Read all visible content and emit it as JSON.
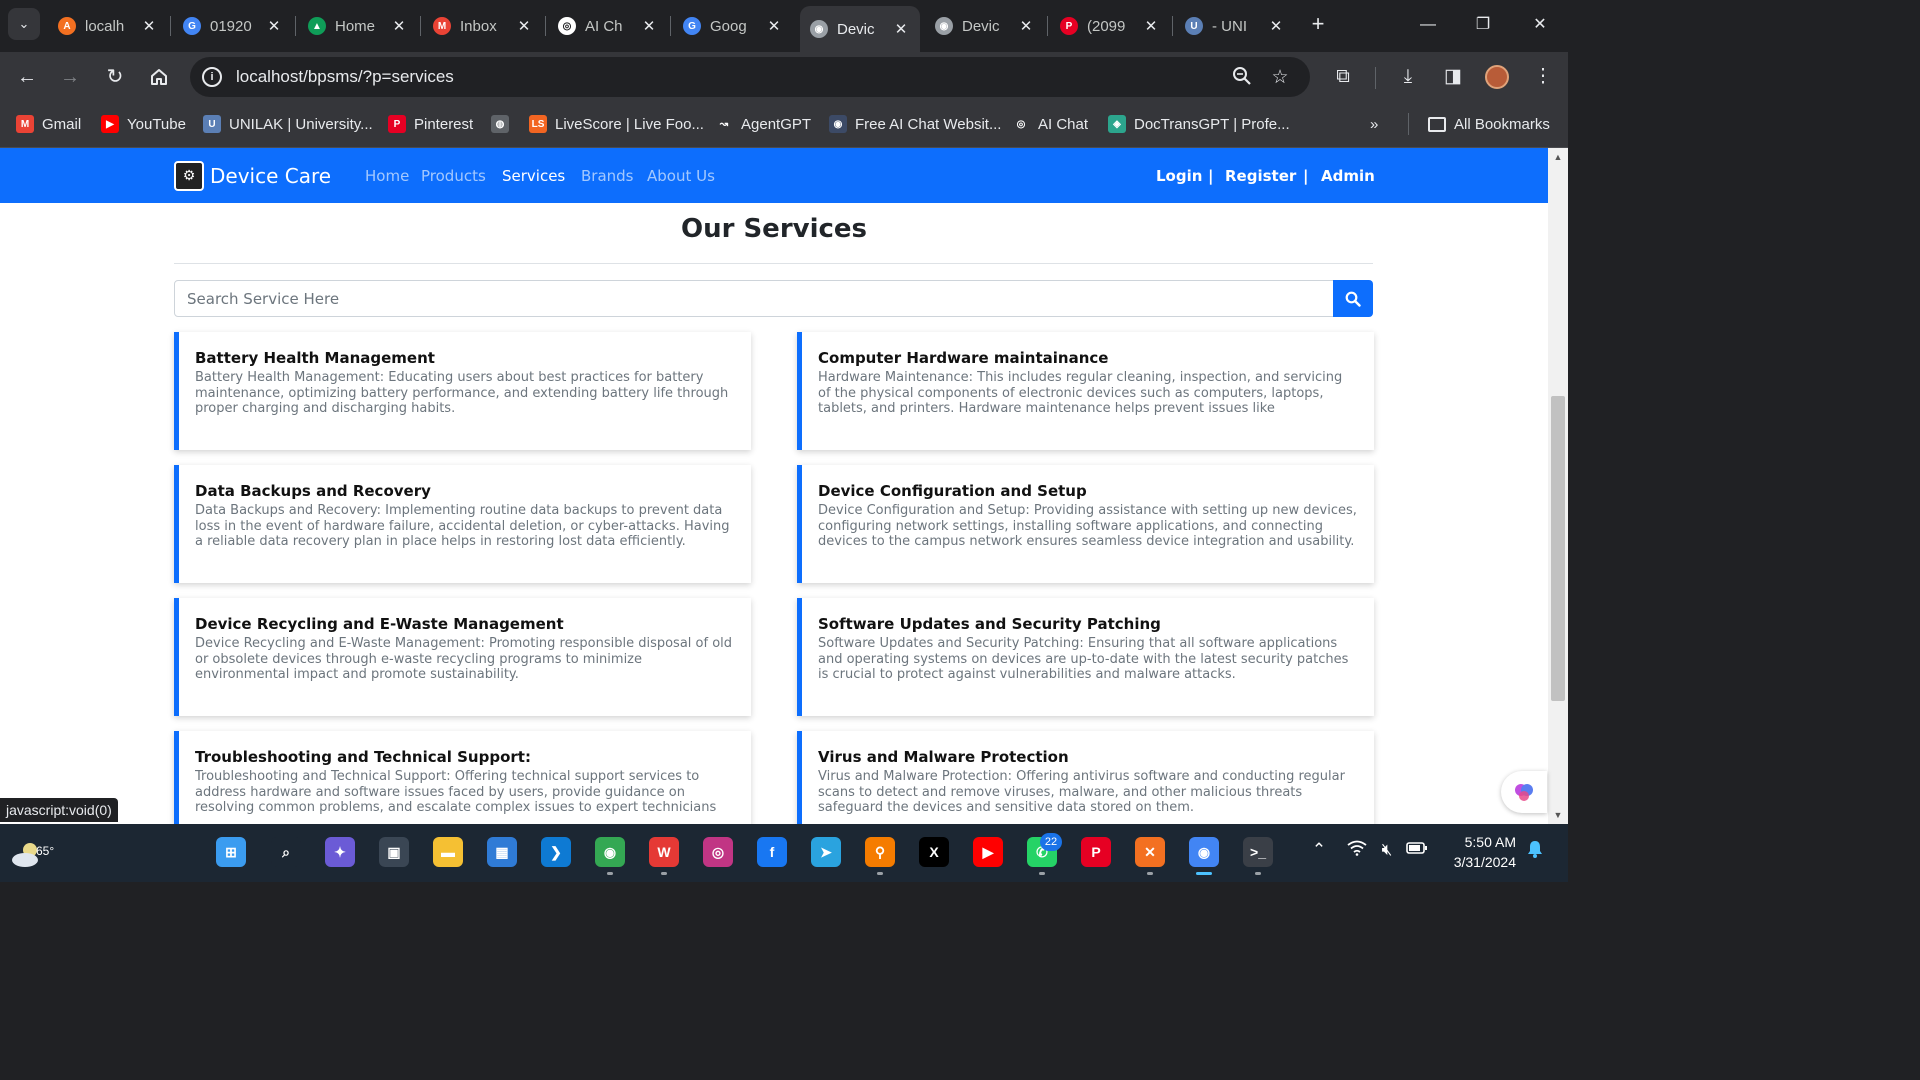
{
  "browser": {
    "tabs": [
      {
        "title": "localh",
        "icon": "xampp-icon",
        "color": "#f37021",
        "glyph": "A"
      },
      {
        "title": "01920",
        "icon": "google-icon",
        "color": "#4285f4",
        "glyph": "G"
      },
      {
        "title": "Home",
        "icon": "drive-icon",
        "color": "#0f9d58",
        "glyph": "▲"
      },
      {
        "title": "Inbox",
        "icon": "gmail-icon",
        "color": "#ea4335",
        "glyph": "M"
      },
      {
        "title": "AI Ch",
        "icon": "openai-icon",
        "color": "#ffffff",
        "glyph": "◎"
      },
      {
        "title": "Goog",
        "icon": "google-icon",
        "color": "#4285f4",
        "glyph": "G"
      },
      {
        "title": "Devic",
        "icon": "device-care-icon",
        "color": "#9aa0a6",
        "glyph": "◉"
      },
      {
        "title": "Devic",
        "icon": "device-care-icon",
        "color": "#9aa0a6",
        "glyph": "◉"
      },
      {
        "title": "(2099",
        "icon": "pinterest-icon",
        "color": "#e60023",
        "glyph": "P"
      },
      {
        "title": "- UNI",
        "icon": "unilak-icon",
        "color": "#5b7fb5",
        "glyph": "U"
      }
    ],
    "active_tab": 6,
    "url": "localhost/bpsms/?p=services",
    "bookmarks": [
      {
        "label": "Gmail",
        "icon": "gmail-icon",
        "color": "#ea4335",
        "glyph": "M"
      },
      {
        "label": "YouTube",
        "icon": "youtube-icon",
        "color": "#ff0000",
        "glyph": "▶"
      },
      {
        "label": "UNILAK | University...",
        "icon": "unilak-icon",
        "color": "#5b7fb5",
        "glyph": "U"
      },
      {
        "label": "Pinterest",
        "icon": "pinterest-icon",
        "color": "#e60023",
        "glyph": "P"
      },
      {
        "label": "",
        "icon": "globe-icon",
        "color": "#5f6368",
        "glyph": "◍"
      },
      {
        "label": "LiveScore | Live Foo...",
        "icon": "livescore-icon",
        "color": "#f26522",
        "glyph": "LS"
      },
      {
        "label": "AgentGPT",
        "icon": "agentgpt-icon",
        "color": "#35363a",
        "glyph": "↝"
      },
      {
        "label": "Free AI Chat Websit...",
        "icon": "ai-chat-icon",
        "color": "#3c4a66",
        "glyph": "◉"
      },
      {
        "label": "AI Chat",
        "icon": "openai-icon",
        "color": "#35363a",
        "glyph": "◎"
      },
      {
        "label": "DocTransGPT | Profe...",
        "icon": "doctrans-icon",
        "color": "#2ca58d",
        "glyph": "◈"
      }
    ],
    "all_bookmarks_label": "All Bookmarks",
    "status_url": "javascript:void(0)"
  },
  "site": {
    "brand": "Device Care",
    "nav": [
      "Home",
      "Products",
      "Services",
      "Brands",
      "About Us"
    ],
    "active_nav": "Services",
    "auth": [
      "Login",
      "Register",
      "Admin"
    ],
    "auth_separator": "|",
    "page_title": "Our Services",
    "search_placeholder": "Search Service Here",
    "search_value": "",
    "accent": "#0d6efd",
    "services": [
      {
        "title": "Battery Health Management",
        "text": "Battery Health Management: Educating users about best practices for battery maintenance, optimizing battery performance, and extending battery life through proper charging and discharging habits."
      },
      {
        "title": "Computer Hardware maintainance",
        "text": "Hardware Maintenance: This includes regular cleaning, inspection, and servicing of the physical components of electronic devices such as computers, laptops, tablets, and printers. Hardware maintenance helps prevent issues like overheating, dust..."
      },
      {
        "title": "Data Backups and Recovery",
        "text": "Data Backups and Recovery: Implementing routine data backups to prevent data loss in the event of hardware failure, accidental deletion, or cyber-attacks. Having a reliable data recovery plan in place helps in restoring lost data efficiently."
      },
      {
        "title": "Device Configuration and Setup",
        "text": "Device Configuration and Setup: Providing assistance with setting up new devices, configuring network settings, installing software applications, and connecting devices to the campus network ensures seamless device integration and usability."
      },
      {
        "title": "Device Recycling and E-Waste Management",
        "text": "Device Recycling and E-Waste Management: Promoting responsible disposal of old or obsolete devices through e-waste recycling programs to minimize environmental impact and promote sustainability."
      },
      {
        "title": "Software Updates and Security Patching",
        "text": "Software Updates and Security Patching: Ensuring that all software applications and operating systems on devices are up-to-date with the latest security patches is crucial to protect against vulnerabilities and malware attacks."
      },
      {
        "title": "Troubleshooting and Technical Support:",
        "text": "Troubleshooting and Technical Support: Offering technical support services to address hardware and software issues faced by users, provide guidance on resolving common problems, and escalate complex issues to expert technicians when needed"
      },
      {
        "title": "Virus and Malware Protection",
        "text": "Virus and Malware Protection: Offering antivirus software and conducting regular scans to detect and remove viruses, malware, and other malicious threats safeguard the devices and sensitive data stored on them."
      }
    ]
  },
  "taskbar": {
    "weather_temp": "65°",
    "whatsapp_badge": "22",
    "time": "5:50 AM",
    "date": "3/31/2024",
    "apps": [
      {
        "icon": "windows-start-icon",
        "color": "#3b9cf0",
        "glyph": "⊞"
      },
      {
        "icon": "search-icon",
        "color": "#1c2733",
        "glyph": "⌕"
      },
      {
        "icon": "copilot-icon",
        "color": "#6b5bd6",
        "glyph": "✦"
      },
      {
        "icon": "task-view-icon",
        "color": "#3a4654",
        "glyph": "▣"
      },
      {
        "icon": "file-explorer-icon",
        "color": "#f5c033",
        "glyph": "▬"
      },
      {
        "icon": "microsoft-store-icon",
        "color": "#2f7bd6",
        "glyph": "▦"
      },
      {
        "icon": "vscode-icon",
        "color": "#0e7ad3",
        "glyph": "❯"
      },
      {
        "icon": "chrome-icon",
        "color": "#34a853",
        "glyph": "◉"
      },
      {
        "icon": "wps-office-icon",
        "color": "#e53935",
        "glyph": "W"
      },
      {
        "icon": "instagram-icon",
        "color": "#c13584",
        "glyph": "◎"
      },
      {
        "icon": "facebook-icon",
        "color": "#1877f2",
        "glyph": "f"
      },
      {
        "icon": "telegram-icon",
        "color": "#2aa3df",
        "glyph": "➤"
      },
      {
        "icon": "search-tool-icon",
        "color": "#f57c00",
        "glyph": "⚲"
      },
      {
        "icon": "x-icon",
        "color": "#000000",
        "glyph": "X"
      },
      {
        "icon": "youtube-icon",
        "color": "#ff0000",
        "glyph": "▶"
      },
      {
        "icon": "whatsapp-icon",
        "color": "#25d366",
        "glyph": "✆"
      },
      {
        "icon": "pinterest-icon",
        "color": "#e60023",
        "glyph": "P"
      },
      {
        "icon": "xampp-icon",
        "color": "#f37021",
        "glyph": "✕"
      },
      {
        "icon": "chrome-profile-icon",
        "color": "#4285f4",
        "glyph": "◉"
      },
      {
        "icon": "terminal-icon",
        "color": "#3a3f47",
        "glyph": ">_"
      }
    ]
  }
}
